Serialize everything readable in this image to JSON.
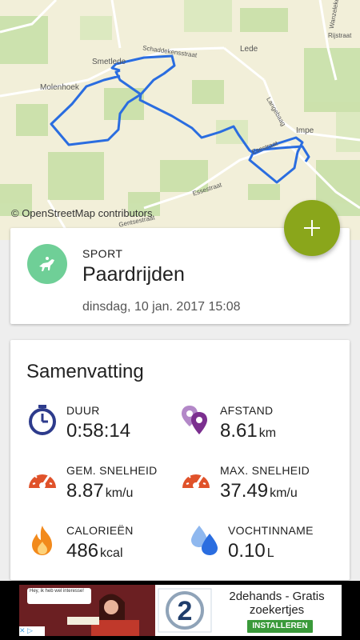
{
  "map": {
    "attribution": "© OpenStreetMap contributors",
    "labels": [
      "Smetlede",
      "Schaddekensstraat",
      "Molenhoek",
      "Lede",
      "Impe",
      "Langebaag",
      "Esestraat",
      "Essestraat",
      "Rijstraat",
      "Wanzeleke",
      "Gentsestraat"
    ],
    "route_color": "#2a6de0"
  },
  "fab": {
    "icon": "plus-icon",
    "color": "#8aa61b"
  },
  "sport": {
    "heading": "SPORT",
    "name": "Paardrijden",
    "date": "dinsdag, 10 jan. 2017 15:08",
    "icon": "horse-riding-icon"
  },
  "summary": {
    "title": "Samenvatting",
    "stats": [
      {
        "label": "DUUR",
        "value": "0:58:14",
        "unit": "",
        "icon": "stopwatch-icon"
      },
      {
        "label": "AFSTAND",
        "value": "8.61",
        "unit": "km",
        "icon": "location-pins-icon"
      },
      {
        "label": "GEM. SNELHEID",
        "value": "8.87",
        "unit": "km/u",
        "icon": "speedometer-icon"
      },
      {
        "label": "MAX. SNELHEID",
        "value": "37.49",
        "unit": "km/u",
        "icon": "speedometer-icon"
      },
      {
        "label": "CALORIEËN",
        "value": "486",
        "unit": "kcal",
        "icon": "flame-icon"
      },
      {
        "label": "VOCHTINNAME",
        "value": "0.10",
        "unit": "L",
        "icon": "water-drops-icon"
      }
    ]
  },
  "ad": {
    "text": "2dehands - Gratis zoekertjes",
    "button": "INSTALLEREN",
    "bubble": "Hey, ik heb wel interesse!",
    "brand": "2dehands.be"
  }
}
